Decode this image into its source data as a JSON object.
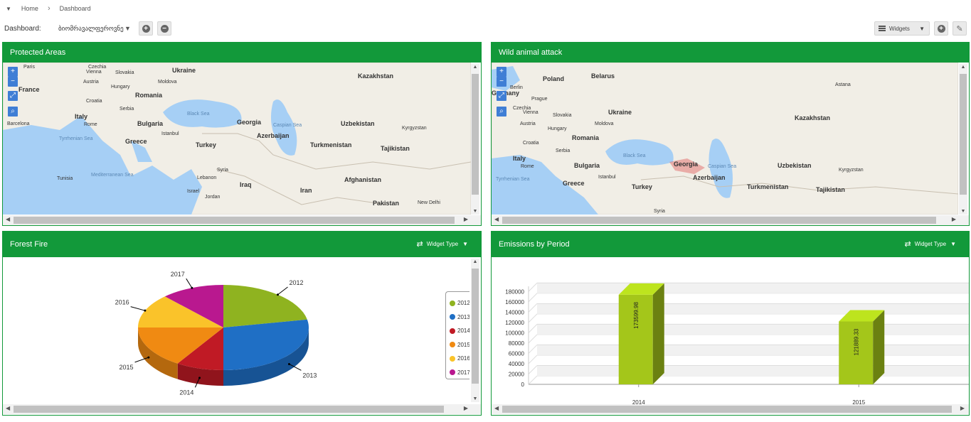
{
  "breadcrumb": {
    "home": "Home",
    "current": "Dashboard"
  },
  "toolbar": {
    "dashboard_label": "Dashboard:",
    "dashboard_name": "ბიომრავალფეროვნე",
    "widgets_label": "Widgets"
  },
  "widgets": {
    "protected_areas": {
      "title": "Protected Areas",
      "countries": [
        "Ukraine",
        "Kazakhstan",
        "France",
        "Romania",
        "Italy",
        "Bulgaria",
        "Georgia",
        "Uzbekistan",
        "Kyrgyzstan",
        "Greece",
        "Turkey",
        "Azerbaijan",
        "Turkmenistan",
        "Tajikistan",
        "Syria",
        "Tunisia",
        "Lebanon",
        "Iraq",
        "Afghanistan",
        "Israel",
        "Jordan",
        "Iran",
        "Pakistan",
        "Czechia",
        "Slovakia",
        "Austria",
        "Hungary",
        "Moldova",
        "Croatia",
        "Serbia"
      ],
      "seas": [
        "Black Sea",
        "Caspian Sea",
        "Tyrrhenian Sea",
        "Mediterranean Sea"
      ],
      "cities": [
        "Paris",
        "Vienna",
        "Rome",
        "Barcelona",
        "Istanbul",
        "New Delhi"
      ]
    },
    "wild_animal_attack": {
      "title": "Wild animal attack",
      "countries": [
        "Poland",
        "Belarus",
        "Germany",
        "Czechia",
        "Slovakia",
        "Ukraine",
        "Austria",
        "Hungary",
        "Moldova",
        "Croatia",
        "Serbia",
        "Romania",
        "Kazakhstan",
        "Italy",
        "Bulgaria",
        "Georgia",
        "Azerbaijan",
        "Uzbekistan",
        "Kyrgyzstan",
        "Greece",
        "Turkey",
        "Turkmenistan",
        "Tajikistan",
        "Syria"
      ],
      "seas": [
        "Black Sea",
        "Caspian Sea",
        "Tyrrhenian Sea"
      ],
      "cities": [
        "Berlin",
        "Prague",
        "Vienna",
        "Rome",
        "Istanbul",
        "Astana"
      ],
      "highlight_color": "#e05a5a"
    },
    "forest_fire": {
      "title": "Forest Fire",
      "widget_type_label": "Widget Type",
      "legend_labels": [
        "2012",
        "2013",
        "2014",
        "2015",
        "2016",
        "2017"
      ]
    },
    "emissions": {
      "title": "Emissions by Period",
      "widget_type_label": "Widget Type"
    }
  },
  "chart_data": [
    {
      "type": "pie",
      "categories": [
        "2012",
        "2013",
        "2014",
        "2015",
        "2016",
        "2017"
      ],
      "values": [
        22,
        28,
        9,
        16,
        13,
        12
      ],
      "colors": [
        "#8fb320",
        "#1f6fc5",
        "#c01a25",
        "#f08a12",
        "#fac32a",
        "#b9188f"
      ]
    },
    {
      "type": "bar",
      "categories": [
        "2014",
        "2015"
      ],
      "values": [
        173599.98,
        121889.33
      ],
      "data_labels": [
        "173599.98",
        "121889.33"
      ],
      "yticks": [
        "0",
        "20000",
        "40000",
        "60000",
        "80000",
        "100000",
        "120000",
        "140000",
        "160000",
        "180000"
      ],
      "ylim": [
        0,
        190000
      ],
      "color": "#a4c61a"
    }
  ]
}
